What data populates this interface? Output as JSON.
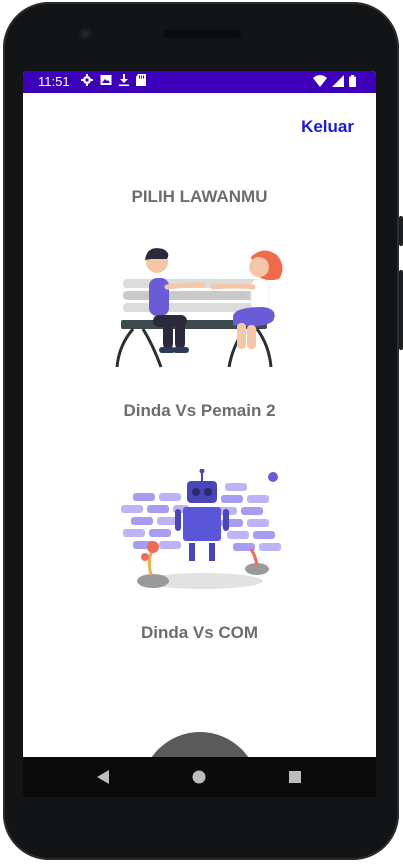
{
  "status_bar": {
    "time": "11:51",
    "left_icons": [
      "settings-icon",
      "image-icon",
      "download-icon",
      "sd-card-icon"
    ],
    "right_icons": [
      "wifi-icon",
      "signal-icon",
      "battery-icon"
    ],
    "color": "#3b00b8"
  },
  "header": {
    "logout_label": "Keluar",
    "logout_color": "#1a1ad8"
  },
  "main": {
    "title": "PILIH LAWANMU",
    "options": [
      {
        "label": "Dinda Vs Pemain 2",
        "icon": "couple-on-bench-illustration"
      },
      {
        "label": "Dinda Vs COM",
        "icon": "robot-illustration"
      }
    ]
  },
  "navigation": {
    "buttons": [
      "back-icon",
      "home-icon",
      "recents-icon"
    ]
  }
}
